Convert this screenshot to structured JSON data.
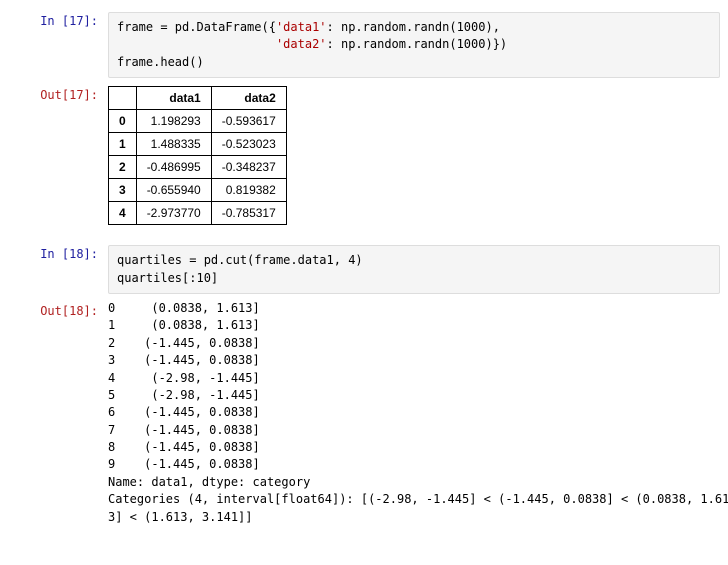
{
  "cells": [
    {
      "type": "input",
      "prompt": "In  [17]:",
      "code_html": "frame = pd.DataFrame({<span class='s'>'data1'</span>: np.random.randn(1000),\n                      <span class='s'>'data2'</span>: np.random.randn(1000)})\nframe.head()"
    },
    {
      "type": "output_table",
      "prompt": "Out[17]:",
      "table": {
        "columns": [
          "data1",
          "data2"
        ],
        "index": [
          "0",
          "1",
          "2",
          "3",
          "4"
        ],
        "rows": [
          [
            "1.198293",
            "-0.593617"
          ],
          [
            "1.488335",
            "-0.523023"
          ],
          [
            "-0.486995",
            "-0.348237"
          ],
          [
            "-0.655940",
            "0.819382"
          ],
          [
            "-2.973770",
            "-0.785317"
          ]
        ]
      }
    },
    {
      "type": "input",
      "prompt": "In  [18]:",
      "code_html": "quartiles = pd.cut(frame.data1, 4)\nquartiles[:10]"
    },
    {
      "type": "output_text",
      "prompt": "Out[18]:",
      "text": "0     (0.0838, 1.613]\n1     (0.0838, 1.613]\n2    (-1.445, 0.0838]\n3    (-1.445, 0.0838]\n4     (-2.98, -1.445]\n5     (-2.98, -1.445]\n6    (-1.445, 0.0838]\n7    (-1.445, 0.0838]\n8    (-1.445, 0.0838]\n9    (-1.445, 0.0838]\nName: data1, dtype: category\nCategories (4, interval[float64]): [(-2.98, -1.445] < (-1.445, 0.0838] < (0.0838, 1.61\n3] < (1.613, 3.141]]"
    }
  ]
}
